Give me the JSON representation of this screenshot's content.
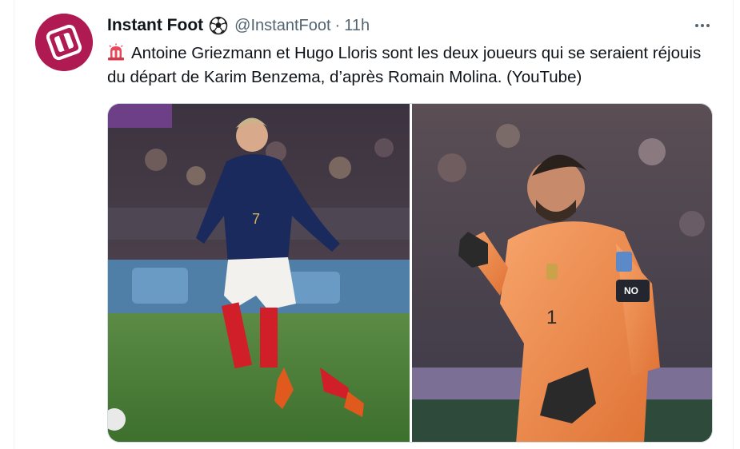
{
  "tweet": {
    "author_name": "Instant Foot",
    "handle": "@InstantFoot",
    "separator": "·",
    "time": "11h",
    "text": "Antoine Griezmann et Hugo Lloris sont les deux joueurs qui se seraient réjouis du départ de Karim Benzema, d’après Romain Molina. (YouTube)",
    "icons": {
      "avatar": "instant-foot-logo",
      "name_badge": "soccer-ball-icon",
      "text_prefix": "rotating-light-icon",
      "more": "more-options-icon"
    }
  },
  "photos": [
    {
      "name": "griezmann-photo",
      "jersey_number": "7"
    },
    {
      "name": "lloris-photo",
      "jersey_number": "1",
      "armband_text": "NO DISCRIMINATION"
    }
  ],
  "colors": {
    "brand": "#b01a52",
    "text": "#0f1419",
    "secondary": "#536471",
    "border": "#cfd9de",
    "france_blue": "#1b2a5c",
    "goalkeeper_orange": "#f08a4b"
  }
}
